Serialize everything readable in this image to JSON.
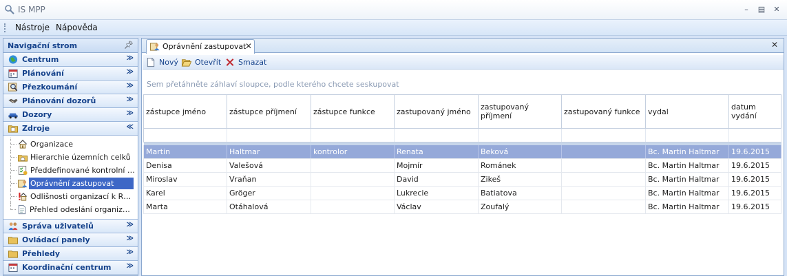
{
  "window": {
    "title": "IS MPP"
  },
  "menu": {
    "items": [
      "Nástroje",
      "Nápověda"
    ]
  },
  "nav": {
    "header": "Navigační strom",
    "groups_top": [
      {
        "label": "Centrum",
        "icon": "globe-icon"
      },
      {
        "label": "Plánování",
        "icon": "calendar-icon"
      },
      {
        "label": "Přezkoumání",
        "icon": "magnifier-icon"
      },
      {
        "label": "Plánování dozorů",
        "icon": "handshake-icon"
      },
      {
        "label": "Dozory",
        "icon": "car-icon"
      },
      {
        "label": "Zdroje",
        "icon": "folder-icon"
      }
    ],
    "zdroje_items": [
      {
        "label": "Organizace",
        "icon": "house-icon"
      },
      {
        "label": "Hierarchie územních celků",
        "icon": "folder-house-icon"
      },
      {
        "label": "Předdefinované kontrolní s...",
        "icon": "checklist-icon"
      },
      {
        "label": "Oprávnění zastupovat",
        "icon": "person-doc-icon",
        "active": true
      },
      {
        "label": "Odlišnosti organizací k RÚIAN",
        "icon": "warning-house-icon"
      },
      {
        "label": "Přehled odeslání organizací ...",
        "icon": "document-icon"
      }
    ],
    "groups_bottom": [
      {
        "label": "Správa uživatelů",
        "icon": "users-icon"
      },
      {
        "label": "Ovládací panely",
        "icon": "folder-icon"
      },
      {
        "label": "Přehledy",
        "icon": "folder-icon"
      },
      {
        "label": "Koordinační centrum",
        "icon": "calendar-icon"
      }
    ]
  },
  "tabs": [
    {
      "label": "Oprávnění zastupovat"
    }
  ],
  "toolbar": {
    "new_label": "Nový",
    "open_label": "Otevřít",
    "delete_label": "Smazat"
  },
  "grid": {
    "group_hint": "Sem přetáhněte záhlaví sloupce, podle kterého chcete seskupovat",
    "columns": [
      "zástupce jméno",
      "zástupce příjmení",
      "zástupce funkce",
      "zastupovaný jméno",
      "zastupovaný příjmení",
      "zastupovaný funkce",
      "vydal",
      "datum vydání"
    ],
    "rows": [
      [
        "Martin",
        "Haltmar",
        "kontrolor",
        "Renata",
        "Beková",
        "",
        "Bc. Martin Haltmar",
        "19.6.2015"
      ],
      [
        "Denisa",
        "Valešová",
        "",
        "Mojmír",
        "Románek",
        "",
        "Bc. Martin Haltmar",
        "19.6.2015"
      ],
      [
        "Miroslav",
        "Vraňan",
        "",
        "David",
        "Zikeš",
        "",
        "Bc. Martin Haltmar",
        "19.6.2015"
      ],
      [
        "Karel",
        "Gröger",
        "",
        "Lukrecie",
        "Batiatova",
        "",
        "Bc. Martin Haltmar",
        "19.6.2015"
      ],
      [
        "Marta",
        "Otáhalová",
        "",
        "Václav",
        "Zoufalý",
        "",
        "Bc. Martin Haltmar",
        "19.6.2015"
      ]
    ],
    "selected_row": 0
  }
}
